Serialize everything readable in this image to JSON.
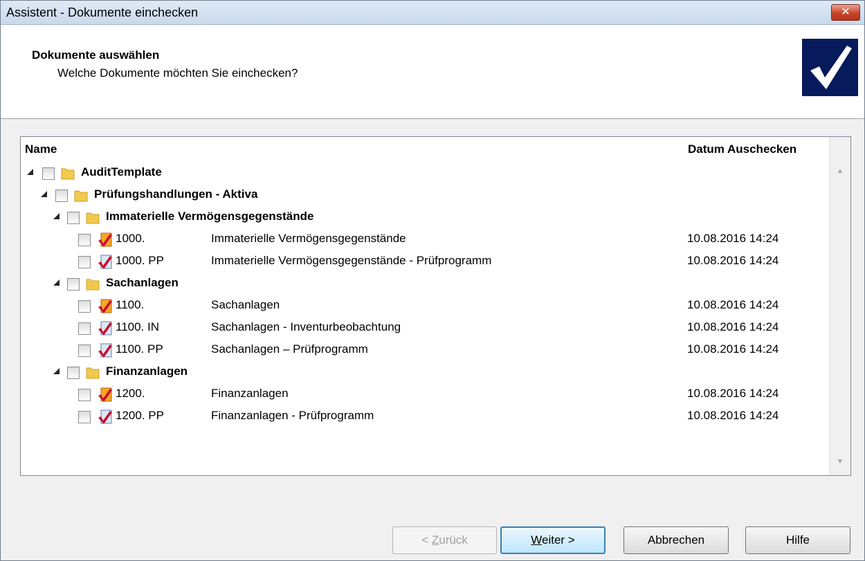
{
  "window": {
    "title": "Assistent - Dokumente einchecken"
  },
  "header": {
    "title": "Dokumente auswählen",
    "subtitle": "Welche Dokumente möchten Sie einchecken?"
  },
  "columns": {
    "name": "Name",
    "date": "Datum Auschecken"
  },
  "tree": {
    "root": "AuditTemplate",
    "group": "Prüfungshandlungen - Aktiva",
    "sections": [
      {
        "label": "Immaterielle Vermögensgegenstände",
        "docs": [
          {
            "num": "1000.",
            "title": "Immaterielle Vermögensgegenstände",
            "date": "10.08.2016 14:24"
          },
          {
            "num": "1000. PP",
            "title": "Immaterielle Vermögensgegenstände - Prüfprogramm",
            "date": "10.08.2016 14:24"
          }
        ]
      },
      {
        "label": "Sachanlagen",
        "docs": [
          {
            "num": "1100.",
            "title": "Sachanlagen",
            "date": "10.08.2016 14:24"
          },
          {
            "num": "1100. IN",
            "title": "Sachanlagen - Inventurbeobachtung",
            "date": "10.08.2016 14:24"
          },
          {
            "num": "1100. PP",
            "title": "Sachanlagen – Prüfprogramm",
            "date": "10.08.2016 14:24"
          }
        ]
      },
      {
        "label": "Finanzanlagen",
        "docs": [
          {
            "num": "1200.",
            "title": "Finanzanlagen",
            "date": "10.08.2016 14:24"
          },
          {
            "num": "1200. PP",
            "title": "Finanzanlagen - Prüfprogramm",
            "date": "10.08.2016 14:24"
          }
        ]
      }
    ]
  },
  "buttons": {
    "back_prefix": "< ",
    "back_mnemonic": "Z",
    "back_rest": "urück",
    "next_mnemonic": "W",
    "next_rest": "eiter >",
    "cancel": "Abbrechen",
    "help": "Hilfe"
  },
  "colors": {
    "accent": "#3c7fb1",
    "logo_bg": "#061a5c",
    "check_red": "#c8102e"
  }
}
